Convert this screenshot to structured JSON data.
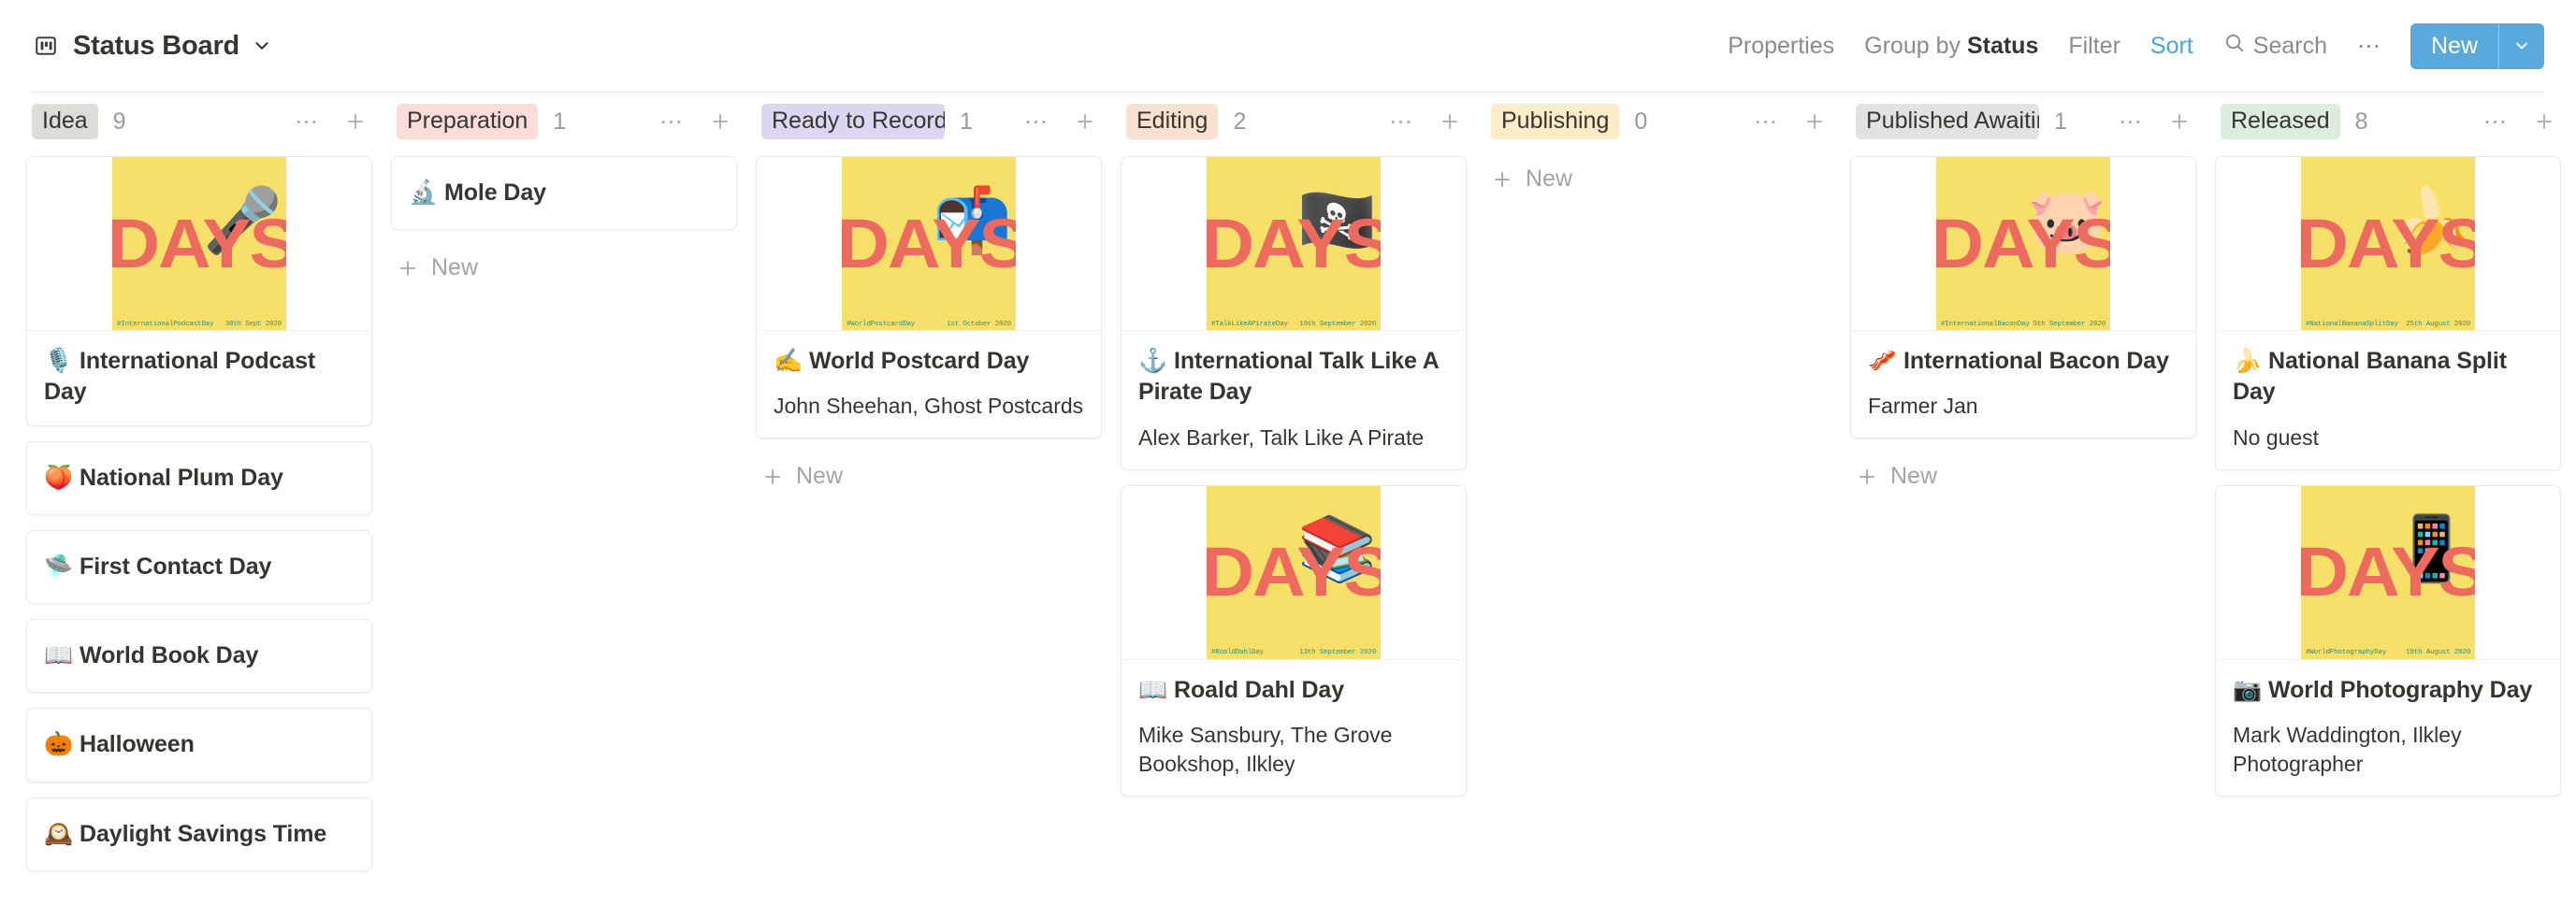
{
  "header": {
    "board_icon": "board-icon",
    "title": "Status Board",
    "chevron": "chevron-down-icon",
    "toolbar": {
      "properties": "Properties",
      "group_by_prefix": "Group by ",
      "group_by_value": "Status",
      "filter": "Filter",
      "sort": "Sort",
      "search": "Search",
      "more": "…",
      "new": "New",
      "new_caret": "chevron-down-icon",
      "accent_color": "#4ba3e3",
      "new_button_color": "#5aa9dd"
    }
  },
  "columns": [
    {
      "status": "Idea",
      "pill_color": "#dddcd9",
      "count": "9",
      "new_label": "New",
      "show_new": false,
      "cards": [
        {
          "type": "cover",
          "emoji": "🎙️",
          "title": "International Podcast Day",
          "subtitle": "",
          "cover": {
            "hashtag": "#InternationalPodcastDay",
            "date": "30th Sept 2020",
            "art_emoji": "🎤",
            "days_text": "DAYS"
          }
        },
        {
          "type": "simple",
          "emoji": "🍑",
          "title": "National Plum Day"
        },
        {
          "type": "simple",
          "emoji": "🛸",
          "title": "First Contact Day"
        },
        {
          "type": "simple",
          "emoji": "📖",
          "title": "World Book Day"
        },
        {
          "type": "simple",
          "emoji": "🎃",
          "title": "Halloween"
        },
        {
          "type": "simple",
          "emoji": "🕰️",
          "title": "Daylight Savings Time"
        }
      ]
    },
    {
      "status": "Preparation",
      "pill_color": "#fbdcd9",
      "count": "1",
      "new_label": "New",
      "show_new": true,
      "cards": [
        {
          "type": "simple",
          "emoji": "🔬",
          "title": "Mole Day"
        }
      ]
    },
    {
      "status": "Ready to Record",
      "pill_color": "#ddd6f3",
      "count": "1",
      "new_label": "New",
      "show_new": true,
      "cards": [
        {
          "type": "cover",
          "emoji": "✍️",
          "title": "World Postcard Day",
          "subtitle": "John Sheehan, Ghost Postcards",
          "cover": {
            "hashtag": "#WorldPostcardDay",
            "date": "1st October 2020",
            "art_emoji": "📬",
            "days_text": "DAYS"
          }
        }
      ]
    },
    {
      "status": "Editing",
      "pill_color": "#fae0d0",
      "count": "2",
      "new_label": "New",
      "show_new": false,
      "cards": [
        {
          "type": "cover",
          "emoji": "⚓",
          "title": "International Talk Like A Pirate Day",
          "subtitle": "Alex Barker, Talk Like A Pirate",
          "cover": {
            "hashtag": "#TalkLikeAPirateDay",
            "date": "19th September 2020",
            "art_emoji": "🏴‍☠️",
            "days_text": "DAYS"
          }
        },
        {
          "type": "cover",
          "emoji": "📖",
          "title": "Roald Dahl Day",
          "subtitle": "Mike Sansbury, The Grove Bookshop, Ilkley",
          "cover": {
            "hashtag": "#RoaldDahlDay",
            "date": "13th September 2020",
            "art_emoji": "📚",
            "days_text": "DAYS"
          }
        }
      ]
    },
    {
      "status": "Publishing",
      "pill_color": "#fdecc8",
      "count": "0",
      "new_label": "New",
      "show_new": true,
      "cards": []
    },
    {
      "status": "Published Awaiting Release",
      "pill_color": "#e3e2e0",
      "count": "1",
      "new_label": "New",
      "show_new": true,
      "cards": [
        {
          "type": "cover",
          "emoji": "🥓",
          "title": "International Bacon Day",
          "subtitle": "Farmer Jan",
          "cover": {
            "hashtag": "#InternationalBaconDay",
            "date": "5th September 2020",
            "art_emoji": "🐷",
            "days_text": "DAYS"
          }
        }
      ]
    },
    {
      "status": "Released",
      "pill_color": "#dbeddb",
      "count": "8",
      "new_label": "New",
      "show_new": false,
      "cards": [
        {
          "type": "cover",
          "emoji": "🍌",
          "title": "National Banana Split Day",
          "subtitle": "No guest",
          "cover": {
            "hashtag": "#NationalBananaSplitDay",
            "date": "25th August 2020",
            "art_emoji": "🍌",
            "days_text": "DAYS"
          }
        },
        {
          "type": "cover",
          "emoji": "📷",
          "title": "World Photography Day",
          "subtitle": "Mark Waddington, Ilkley Photographer",
          "cover": {
            "hashtag": "#WorldPhotographyDay",
            "date": "19th August 2020",
            "art_emoji": "📱",
            "days_text": "DAYS"
          }
        }
      ]
    }
  ]
}
